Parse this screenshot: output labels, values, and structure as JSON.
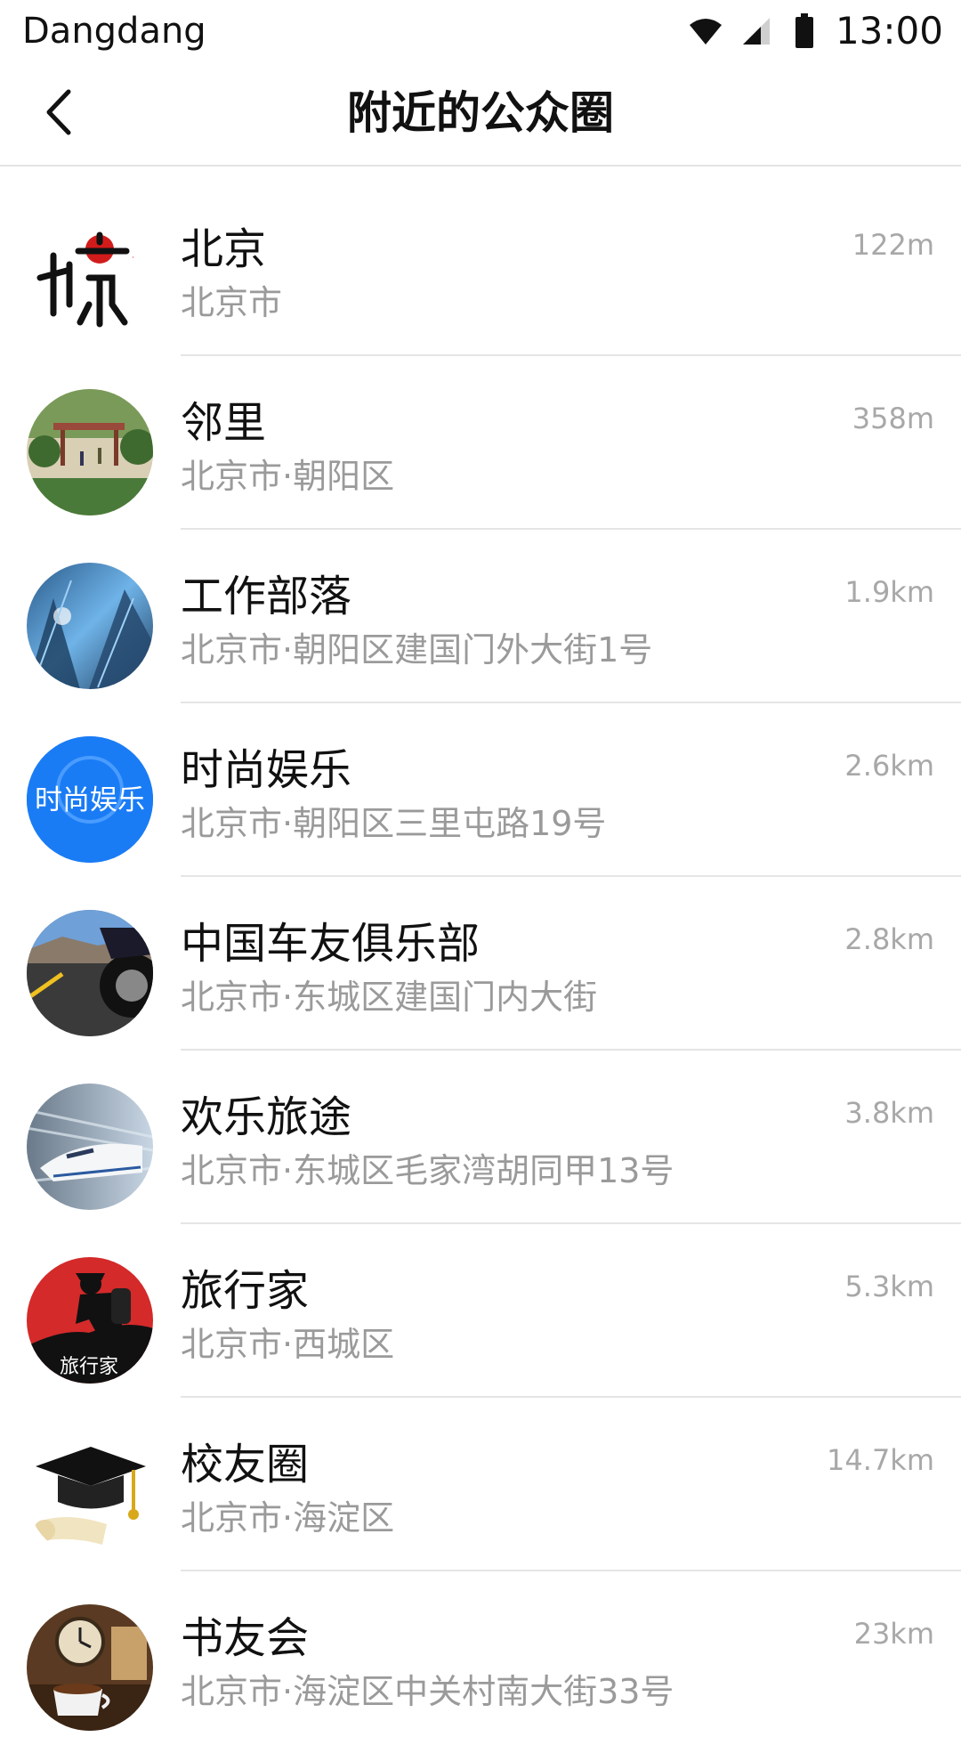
{
  "status_bar": {
    "carrier": "Dangdang",
    "time": "13:00",
    "icons": [
      "wifi-icon",
      "cell-signal-icon",
      "battery-icon"
    ]
  },
  "header": {
    "back_icon": "chevron-left-icon",
    "title": "附近的公众圈"
  },
  "circles": [
    {
      "name": "北京",
      "address": "北京市",
      "distance": "122m",
      "avatar": "beijing-logo"
    },
    {
      "name": "邻里",
      "address": "北京市·朝阳区",
      "distance": "358m",
      "avatar": "park-photo"
    },
    {
      "name": "工作部落",
      "address": "北京市·朝阳区建国门外大街1号",
      "distance": "1.9km",
      "avatar": "skyscraper-photo"
    },
    {
      "name": "时尚娱乐",
      "address": "北京市·朝阳区三里屯路19号",
      "distance": "2.6km",
      "avatar": "fashion-badge",
      "avatar_text": "时尚娱乐"
    },
    {
      "name": "中国车友俱乐部",
      "address": "北京市·东城区建国门内大街",
      "distance": "2.8km",
      "avatar": "car-road-photo"
    },
    {
      "name": "欢乐旅途",
      "address": "北京市·东城区毛家湾胡同甲13号",
      "distance": "3.8km",
      "avatar": "bullet-train-photo"
    },
    {
      "name": "旅行家",
      "address": "北京市·西城区",
      "distance": "5.3km",
      "avatar": "traveler-silhouette",
      "avatar_text": "旅行家"
    },
    {
      "name": "校友圈",
      "address": "北京市·海淀区",
      "distance": "14.7km",
      "avatar": "graduation-cap"
    },
    {
      "name": "书友会",
      "address": "北京市·海淀区中关村南大街33号",
      "distance": "23km",
      "avatar": "coffee-clock-photo"
    }
  ],
  "colors": {
    "fashion_blue": "#1a7cf5",
    "traveler_red": "#d42a2a",
    "secondary_text": "#9a9a9a",
    "separator": "#e5e5e5"
  }
}
